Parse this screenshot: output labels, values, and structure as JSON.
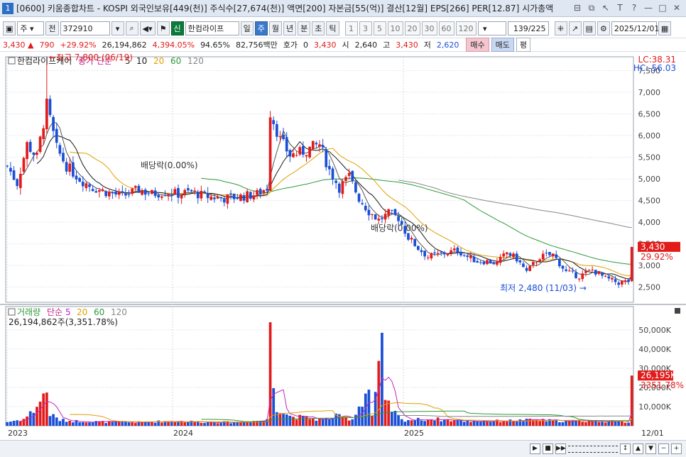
{
  "window": {
    "screen_no": "1",
    "title": "[0600] 키움종합차트 - KOSPI 외국인보유[449(천)] 주식수[27,674(천)] 액면[200] 자본금[55(억)] 결산[12월] EPS[266] PER[12.87] 시가총액",
    "controls": [
      "⊟",
      "⧉",
      "↖",
      "T",
      "?",
      "—",
      "□",
      "✕"
    ]
  },
  "toolbar": {
    "period_select": "주",
    "prev_label": "전",
    "code": "372910",
    "new_badge": "신",
    "stock_name": "한컴라이프",
    "periods": [
      "일",
      "주",
      "월",
      "년",
      "분",
      "초",
      "틱"
    ],
    "active_period": "주",
    "intervals": [
      "1",
      "3",
      "5",
      "10",
      "20",
      "30",
      "60",
      "120"
    ],
    "count": "139",
    "count_total": "/225",
    "date": "2025/12/01"
  },
  "quote": {
    "price": "3,430",
    "change": "790",
    "change_pct": "+29.92%",
    "volume": "26,194,862",
    "volume_pct": "4,394.05%",
    "turnover": "94.65%",
    "trade_value": "82,756백만",
    "hoga_label": "호가",
    "hoga_value": "0",
    "ask": "3,430",
    "open_label": "시",
    "open": "2,640",
    "high_label": "고",
    "high": "3,430",
    "low_label": "저",
    "low": "2,620",
    "buy_label": "매수",
    "sell_label": "매도",
    "flat_label": "평"
  },
  "chart_data": {
    "type": "candlestick",
    "stock_label": "한컴라이프케어",
    "price_legend": {
      "label": "종가 단순",
      "ma": [
        "5",
        "10",
        "20",
        "60",
        "120"
      ],
      "colors": [
        "#2b2b2b",
        "#1a1a1a",
        "#e0a000",
        "#2e9a3a",
        "#888888"
      ]
    },
    "price_axis_ticks": [
      "7,500",
      "7,000",
      "6,500",
      "6,000",
      "5,500",
      "5,000",
      "4,500",
      "4,000",
      "3,500",
      "3,000",
      "2,500"
    ],
    "price_axis_range": [
      2150,
      7820
    ],
    "lc_label": "LC:38.31",
    "hc_label": "HC:-56.03",
    "current_price_tag": "3,430",
    "current_pct_tag": "29.92%",
    "high_marker": "최고 7,800 (06/19)",
    "low_marker": "최저 2,480 (11/03)",
    "dividend_label_1": "배당락(0.00%)",
    "dividend_label_2": "배당락(0.00%)",
    "volume_legend": {
      "label": "거래량",
      "ma_label": "단순",
      "ma": [
        "5",
        "20",
        "60",
        "120"
      ]
    },
    "volume_info": "26,194,862주(3,351.78%)",
    "volume_axis_ticks": [
      "50,000K",
      "40,000K",
      "30,000K",
      "20,000K",
      "10,000K"
    ],
    "volume_axis_max": 57000,
    "current_volume_tag": "26,195K",
    "current_volume_pct_tag": "3351.78%",
    "x_labels": [
      "2023",
      "2024",
      "2025",
      "12/01"
    ],
    "weeks": 150,
    "close_anchors": [
      [
        0,
        5300
      ],
      [
        3,
        4900
      ],
      [
        6,
        5800
      ],
      [
        9,
        5500
      ],
      [
        12,
        6700
      ],
      [
        15,
        5700
      ],
      [
        18,
        5300
      ],
      [
        22,
        5000
      ],
      [
        26,
        4800
      ],
      [
        30,
        4700
      ],
      [
        35,
        4600
      ],
      [
        40,
        4750
      ],
      [
        44,
        4650
      ],
      [
        48,
        4700
      ],
      [
        52,
        4650
      ],
      [
        56,
        4700
      ],
      [
        60,
        4600
      ],
      [
        66,
        4550
      ],
      [
        72,
        4600
      ],
      [
        76,
        4650
      ],
      [
        79,
        4800
      ],
      [
        80,
        6550
      ],
      [
        83,
        5900
      ],
      [
        86,
        5550
      ],
      [
        89,
        5600
      ],
      [
        92,
        5700
      ],
      [
        95,
        5800
      ],
      [
        98,
        5200
      ],
      [
        101,
        4800
      ],
      [
        104,
        5050
      ],
      [
        107,
        4550
      ],
      [
        110,
        4250
      ],
      [
        113,
        4050
      ],
      [
        116,
        4200
      ],
      [
        119,
        4100
      ],
      [
        122,
        3650
      ],
      [
        125,
        3400
      ],
      [
        128,
        3200
      ],
      [
        131,
        3250
      ],
      [
        134,
        3300
      ],
      [
        137,
        3350
      ],
      [
        140,
        3200
      ],
      [
        143,
        3100
      ],
      [
        146,
        3100
      ],
      [
        149,
        3050
      ],
      [
        152,
        3300
      ],
      [
        155,
        3150
      ],
      [
        158,
        2850
      ],
      [
        162,
        3200
      ],
      [
        166,
        3250
      ],
      [
        170,
        2850
      ],
      [
        174,
        2750
      ],
      [
        178,
        2900
      ],
      [
        182,
        2700
      ],
      [
        186,
        2600
      ],
      [
        189,
        2640
      ],
      [
        190,
        3430
      ]
    ],
    "volume_anchors": [
      [
        0,
        2000
      ],
      [
        5,
        3500
      ],
      [
        8,
        8000
      ],
      [
        12,
        18000
      ],
      [
        13,
        6000
      ],
      [
        16,
        3000
      ],
      [
        20,
        2500
      ],
      [
        30,
        2000
      ],
      [
        40,
        1800
      ],
      [
        50,
        2500
      ],
      [
        60,
        2000
      ],
      [
        70,
        1800
      ],
      [
        79,
        3000
      ],
      [
        80,
        54000
      ],
      [
        81,
        22000
      ],
      [
        82,
        10000
      ],
      [
        86,
        5000
      ],
      [
        92,
        4000
      ],
      [
        96,
        3000
      ],
      [
        100,
        5000
      ],
      [
        105,
        3500
      ],
      [
        110,
        20000
      ],
      [
        111,
        5000
      ],
      [
        114,
        39000
      ],
      [
        115,
        12000
      ],
      [
        120,
        3000
      ],
      [
        130,
        3500
      ],
      [
        140,
        2500
      ],
      [
        150,
        2500
      ],
      [
        160,
        3000
      ],
      [
        170,
        2500
      ],
      [
        180,
        2500
      ],
      [
        189,
        2000
      ],
      [
        190,
        26195
      ]
    ]
  },
  "bottom_controls": [
    "▶",
    "■",
    "▶▶",
    "↕",
    "▲",
    "▼",
    "−",
    "+"
  ]
}
